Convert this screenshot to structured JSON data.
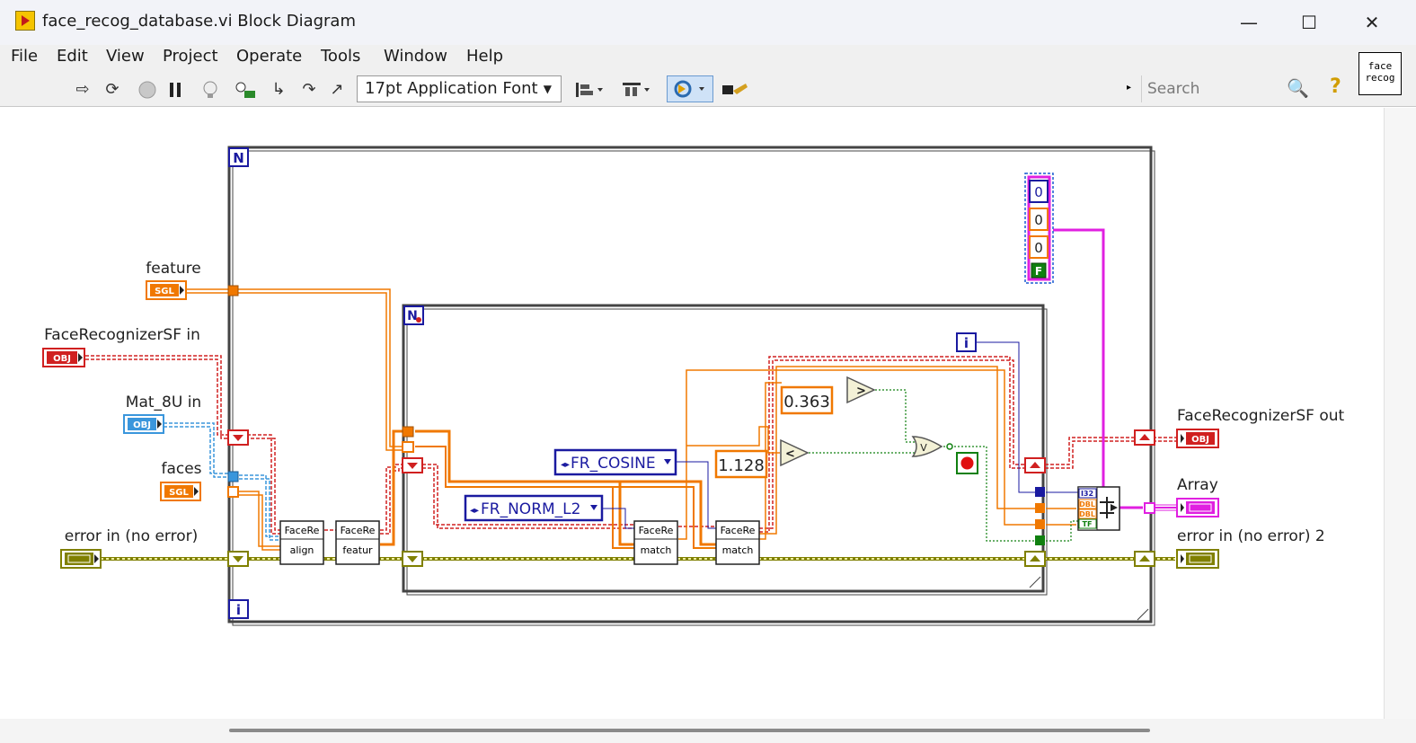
{
  "window": {
    "title": "face_recog_database.vi Block Diagram",
    "minimize_glyph": "—",
    "maximize_glyph": "☐",
    "close_glyph": "✕"
  },
  "menu": [
    "File",
    "Edit",
    "View",
    "Project",
    "Operate",
    "Tools",
    "Window",
    "Help"
  ],
  "toolbar": {
    "font_label": "17pt Application Font",
    "search_placeholder": "Search",
    "icons": [
      "run-arrow-icon",
      "run-continuous-icon",
      "abort-icon",
      "pause-icon",
      "highlight-bulb-icon",
      "retain-wire-values-icon",
      "step-into-icon",
      "step-over-icon",
      "step-out-icon",
      "align-icon",
      "distribute-icon",
      "reorder-icon",
      "cleanup-icon",
      "search-icon",
      "help-icon"
    ]
  },
  "vi_icon": {
    "line1": "face",
    "line2": "recog"
  },
  "diagram": {
    "inputs": {
      "feature": "feature",
      "feature_type": "SGL",
      "recognizer_in": "FaceRecognizerSF in",
      "recognizer_type": "OBJ",
      "mat_in": "Mat_8U in",
      "mat_type": "OBJ",
      "faces": "faces",
      "faces_type": "SGL",
      "error_in": "error in (no error)"
    },
    "outputs": {
      "recognizer_out": "FaceRecognizerSF out",
      "array": "Array",
      "error_out": "error in (no error) 2"
    },
    "outer_loop_count": "N",
    "outer_loop_index": "i",
    "inner_loop_count": "N",
    "inner_loop_index": "i",
    "constants": {
      "cosine_enum": "FR_COSINE",
      "norm_enum": "FR_NORM_L2",
      "threshold_cos": "0.363",
      "threshold_l2": "1.128",
      "cluster_vals": [
        "0",
        "0",
        "0"
      ],
      "cluster_bool": "F"
    },
    "subvis": {
      "align_top": "FaceRe",
      "align_bottom": "align",
      "feature_top": "FaceRe",
      "feature_bottom": "featur",
      "match1_top": "FaceRe",
      "match1_bottom": "match",
      "match2_top": "FaceRe",
      "match2_bottom": "match"
    },
    "bundle_rows": [
      "I32",
      "DBL",
      "DBL",
      "TF"
    ],
    "greater_glyph": ">",
    "less_glyph": "<",
    "or_glyph": "V"
  },
  "colors": {
    "orange": "#f07800",
    "red_dashed": "#d02020",
    "blue": "#1a1aa0",
    "light_blue": "#3a96dc",
    "olive": "#808000",
    "magenta": "#e020e0",
    "green": "#108010"
  }
}
